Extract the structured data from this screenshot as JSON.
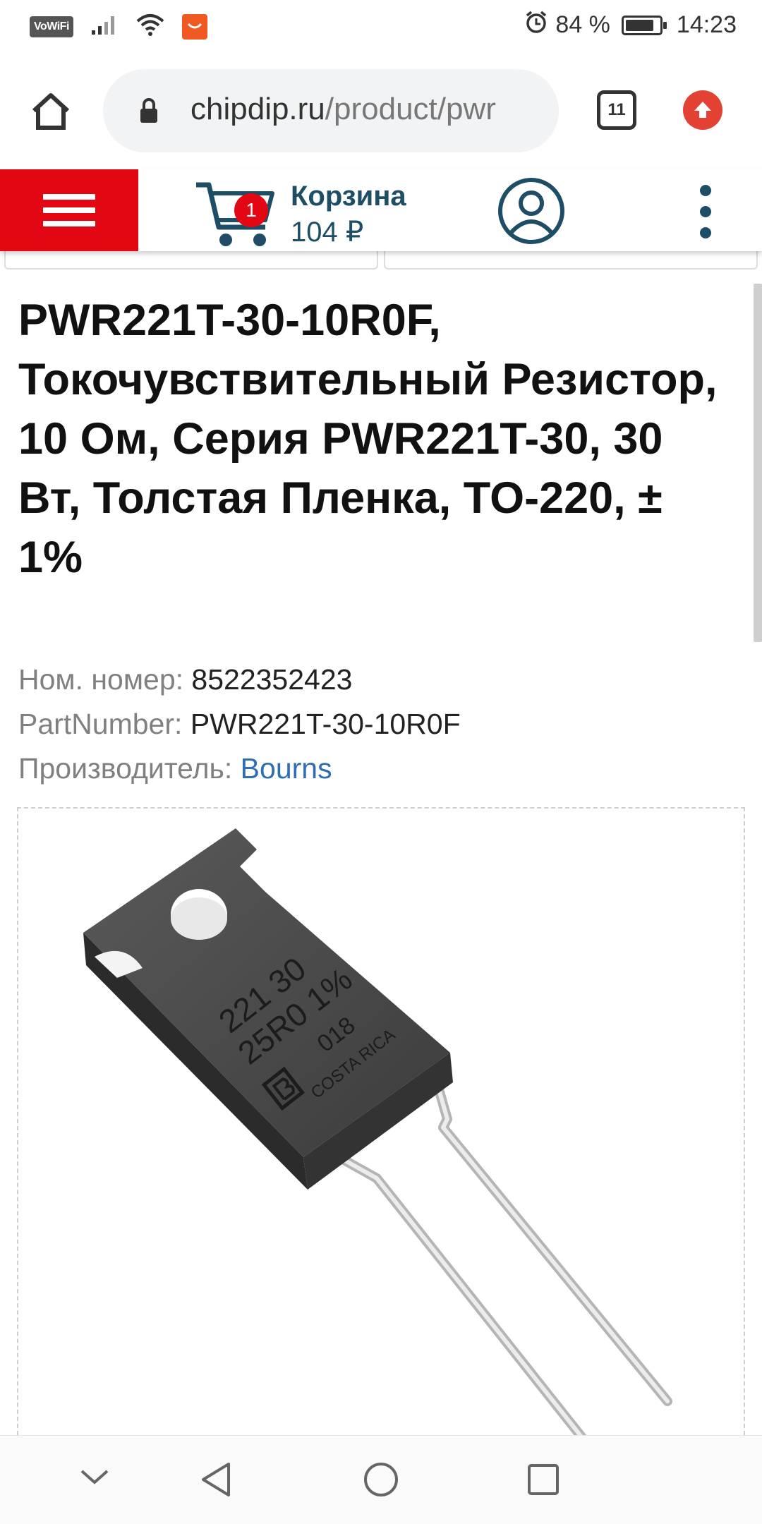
{
  "status_bar": {
    "network_label": "VoWiFi",
    "battery_percent": "84 %",
    "battery_level": 0.84,
    "time": "14:23",
    "icons": [
      "vowifi-badge",
      "signal-icon",
      "wifi-icon",
      "app-notification-icon",
      "alarm-icon",
      "battery-icon"
    ]
  },
  "browser": {
    "url_domain": "chipdip.ru",
    "url_path": "/product/pwr",
    "tabs_count": "11",
    "icons": [
      "home-icon",
      "lock-icon",
      "tabs-icon",
      "update-icon"
    ]
  },
  "site_header": {
    "cart_count": "1",
    "cart_label": "Корзина",
    "cart_sum": "104 ₽",
    "colors": {
      "brand_red": "#e30613",
      "brand_blue": "#1e4e66"
    },
    "icons": [
      "menu-icon",
      "cart-icon",
      "user-icon",
      "more-vert-icon"
    ]
  },
  "product": {
    "title": "PWR221T-30-10R0F, Токочувствительный Резистор, 10 Ом, Серия PWR221T-30, 30 Вт, Толстая Пленка, TO-220, ± 1%",
    "item_number_label": "Ном. номер:",
    "item_number": "8522352423",
    "part_number_label": "PartNumber:",
    "part_number": "PWR221T-30-10R0F",
    "manufacturer_label": "Производитель:",
    "manufacturer": "Bourns",
    "image_markings": {
      "line1": "221 30",
      "line2": "25R0 1%",
      "line3": "018",
      "line4": "COSTA RICA"
    },
    "colors": {
      "link": "#2f6eb5",
      "label": "#808080"
    }
  },
  "nav_bar": {
    "icons": [
      "chevron-down-icon",
      "back-icon",
      "home-circle-icon",
      "recents-icon"
    ]
  }
}
